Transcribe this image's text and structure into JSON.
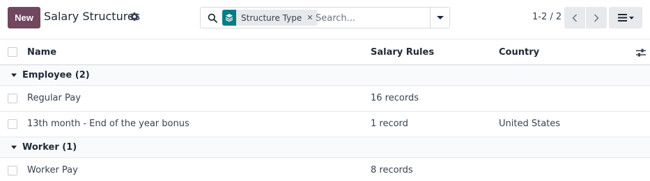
{
  "toolbar": {
    "new_label": "New",
    "title": "Salary Structures"
  },
  "search": {
    "facet_label": "Structure Type",
    "placeholder": "Search..."
  },
  "pager": {
    "range": "1-2 / 2"
  },
  "table": {
    "columns": {
      "name": "Name",
      "salary_rules": "Salary Rules",
      "country": "Country"
    },
    "groups": [
      {
        "label": "Employee (2)",
        "rows": [
          {
            "name": "Regular Pay",
            "salary_rules": "16 records",
            "country": ""
          },
          {
            "name": "13th month - End of the year bonus",
            "salary_rules": "1 record",
            "country": "United States"
          }
        ]
      },
      {
        "label": "Worker (1)",
        "rows": [
          {
            "name": "Worker Pay",
            "salary_rules": "8 records",
            "country": ""
          }
        ]
      }
    ]
  },
  "colors": {
    "primary": "#71465f",
    "facet_icon": "#017e84"
  }
}
